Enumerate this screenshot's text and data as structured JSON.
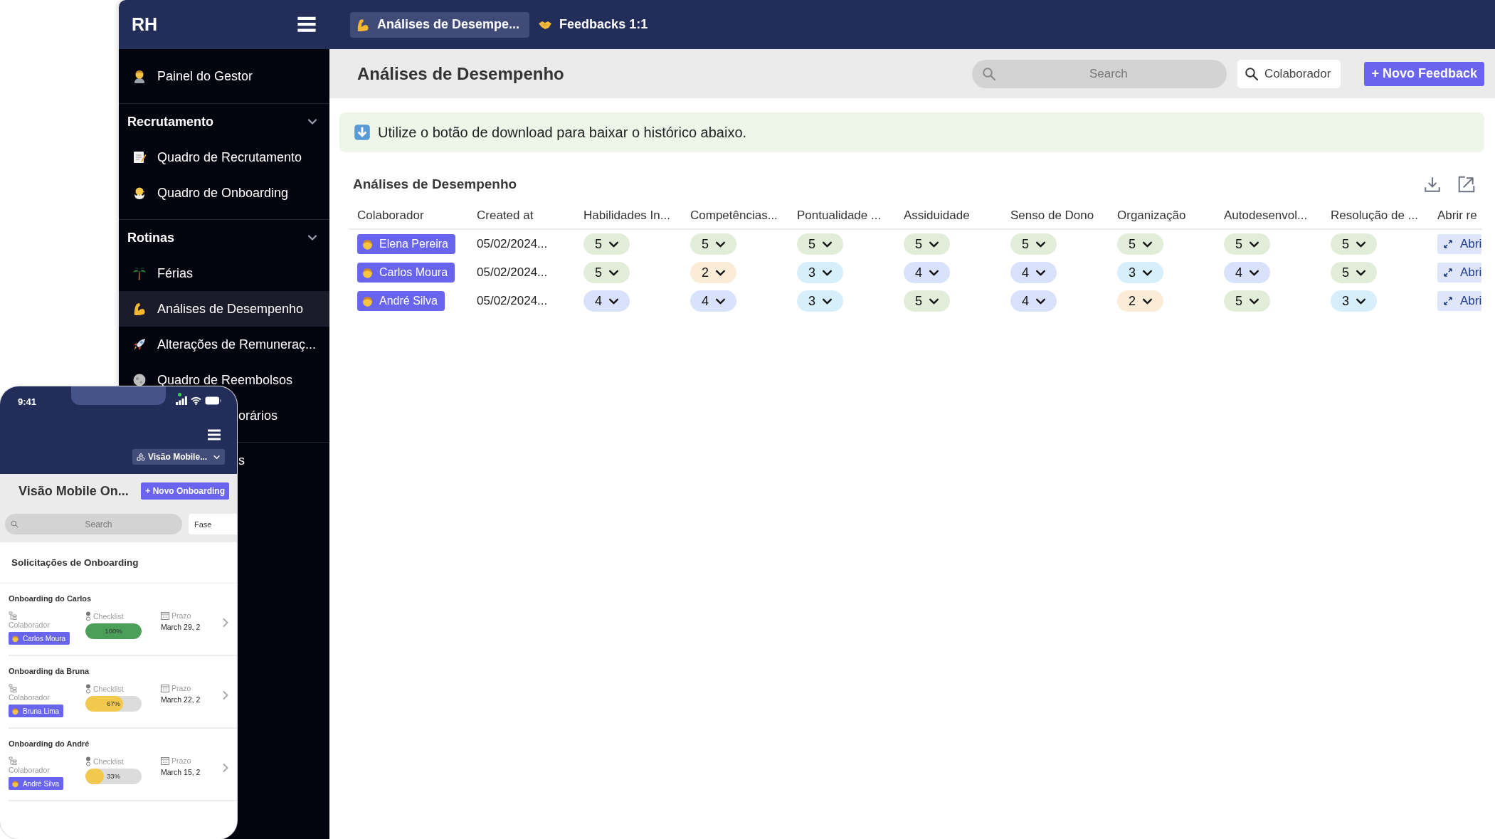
{
  "desktop": {
    "topbar": {
      "brand": "RH",
      "tabs": [
        {
          "label": "Análises de Desempe...",
          "selected": true
        },
        {
          "label": "Feedbacks 1:1",
          "selected": false
        }
      ]
    },
    "sidebar": {
      "top_items": [
        {
          "label": "Painel do Gestor",
          "selected": false,
          "kind": "item"
        }
      ],
      "sections": [
        {
          "title": "Recrutamento",
          "expanded": true,
          "items": [
            {
              "label": "Quadro de Recrutamento",
              "selected": false,
              "kind": "item"
            },
            {
              "label": "Quadro de Onboarding",
              "selected": false,
              "kind": "item"
            }
          ]
        },
        {
          "title": "Rotinas",
          "expanded": true,
          "items": [
            {
              "label": "Férias",
              "selected": false,
              "kind": "item"
            },
            {
              "label": "Análises de Desempenho",
              "selected": true,
              "kind": "item"
            },
            {
              "label": "Alterações de Remuneraç...",
              "selected": false,
              "kind": "item"
            },
            {
              "label": "Quadro de Reembolsos",
              "selected": false,
              "kind": "item"
            },
            {
              "label": "orários",
              "selected": false,
              "kind": "clipped"
            }
          ]
        },
        {
          "items": [
            {
              "label": "s",
              "selected": false,
              "kind": "clipped"
            }
          ]
        }
      ]
    },
    "main": {
      "header": {
        "title": "Análises de Desempenho",
        "search": {
          "placeholder": "Search"
        },
        "filter_button": "Colaborador",
        "new_button": "+ Novo Feedback"
      },
      "banner": "Utilize o botão de download para baixar o histórico abaixo.",
      "table": {
        "title": "Análises de Desempenho",
        "columns": [
          "Colaborador",
          "Created at",
          "Habilidades In...",
          "Competências...",
          "Pontualidade ...",
          "Assiduidade",
          "Senso de Dono",
          "Organização",
          "Autodesenvol...",
          "Resolução de ...",
          "Abrir re"
        ],
        "rows": [
          {
            "collaborator": "Elena Pereira",
            "created_at": "05/02/2024...",
            "ratings": [
              {
                "value": "5",
                "color": "#e2edd9"
              },
              {
                "value": "5",
                "color": "#e2edd9"
              },
              {
                "value": "5",
                "color": "#e2edd9"
              },
              {
                "value": "5",
                "color": "#e2edd9"
              },
              {
                "value": "5",
                "color": "#e2edd9"
              },
              {
                "value": "5",
                "color": "#e2edd9"
              },
              {
                "value": "5",
                "color": "#e2edd9"
              },
              {
                "value": "5",
                "color": "#e2edd9"
              }
            ],
            "action": "Abri"
          },
          {
            "collaborator": "Carlos Moura",
            "created_at": "05/02/2024...",
            "ratings": [
              {
                "value": "5",
                "color": "#e2edd9"
              },
              {
                "value": "2",
                "color": "#fbecd7"
              },
              {
                "value": "3",
                "color": "#d6effb"
              },
              {
                "value": "4",
                "color": "#d9e2fb"
              },
              {
                "value": "4",
                "color": "#d9e2fb"
              },
              {
                "value": "3",
                "color": "#d6effb"
              },
              {
                "value": "4",
                "color": "#d9e2fb"
              },
              {
                "value": "5",
                "color": "#e2edd9"
              }
            ],
            "action": "Abri"
          },
          {
            "collaborator": "André Silva",
            "created_at": "05/02/2024...",
            "ratings": [
              {
                "value": "4",
                "color": "#d9e2fb"
              },
              {
                "value": "4",
                "color": "#d9e2fb"
              },
              {
                "value": "3",
                "color": "#d6effb"
              },
              {
                "value": "5",
                "color": "#e2edd9"
              },
              {
                "value": "4",
                "color": "#d9e2fb"
              },
              {
                "value": "2",
                "color": "#fbecd7"
              },
              {
                "value": "5",
                "color": "#e2edd9"
              },
              {
                "value": "3",
                "color": "#d6effb"
              }
            ],
            "action": "Abri"
          }
        ]
      }
    }
  },
  "phone": {
    "status_time": "9:41",
    "view_select": "Visão Mobile...",
    "title": "Visão Mobile On...",
    "new_button": "+ Novo Onboarding",
    "search": {
      "placeholder": "Search"
    },
    "filter": "Fase",
    "list_title": "Solicitações de Onboarding",
    "cards": [
      {
        "title": "Onboarding do Carlos",
        "collaborator_label": "Colaborador",
        "collaborator": "Carlos Moura",
        "checklist_label": "Checklist",
        "progress": {
          "level": 1,
          "reading": "100%",
          "color": "#4b9f58"
        },
        "deadline_label": "Prazo",
        "deadline": "March 29, 2"
      },
      {
        "title": "Onboarding da Bruna",
        "collaborator_label": "Colaborador",
        "collaborator": "Bruna Lima",
        "checklist_label": "Checklist",
        "progress": {
          "level": 0.67,
          "reading": "67%",
          "color": "#f2c94c"
        },
        "deadline_label": "Prazo",
        "deadline": "March 22, 2"
      },
      {
        "title": "Onboarding do André",
        "collaborator_label": "Colaborador",
        "collaborator": "André Silva",
        "checklist_label": "Checklist",
        "progress": {
          "level": 0.33,
          "reading": "33%",
          "color": "#f2c94c"
        },
        "deadline_label": "Prazo",
        "deadline": "March 15, 2"
      }
    ]
  }
}
